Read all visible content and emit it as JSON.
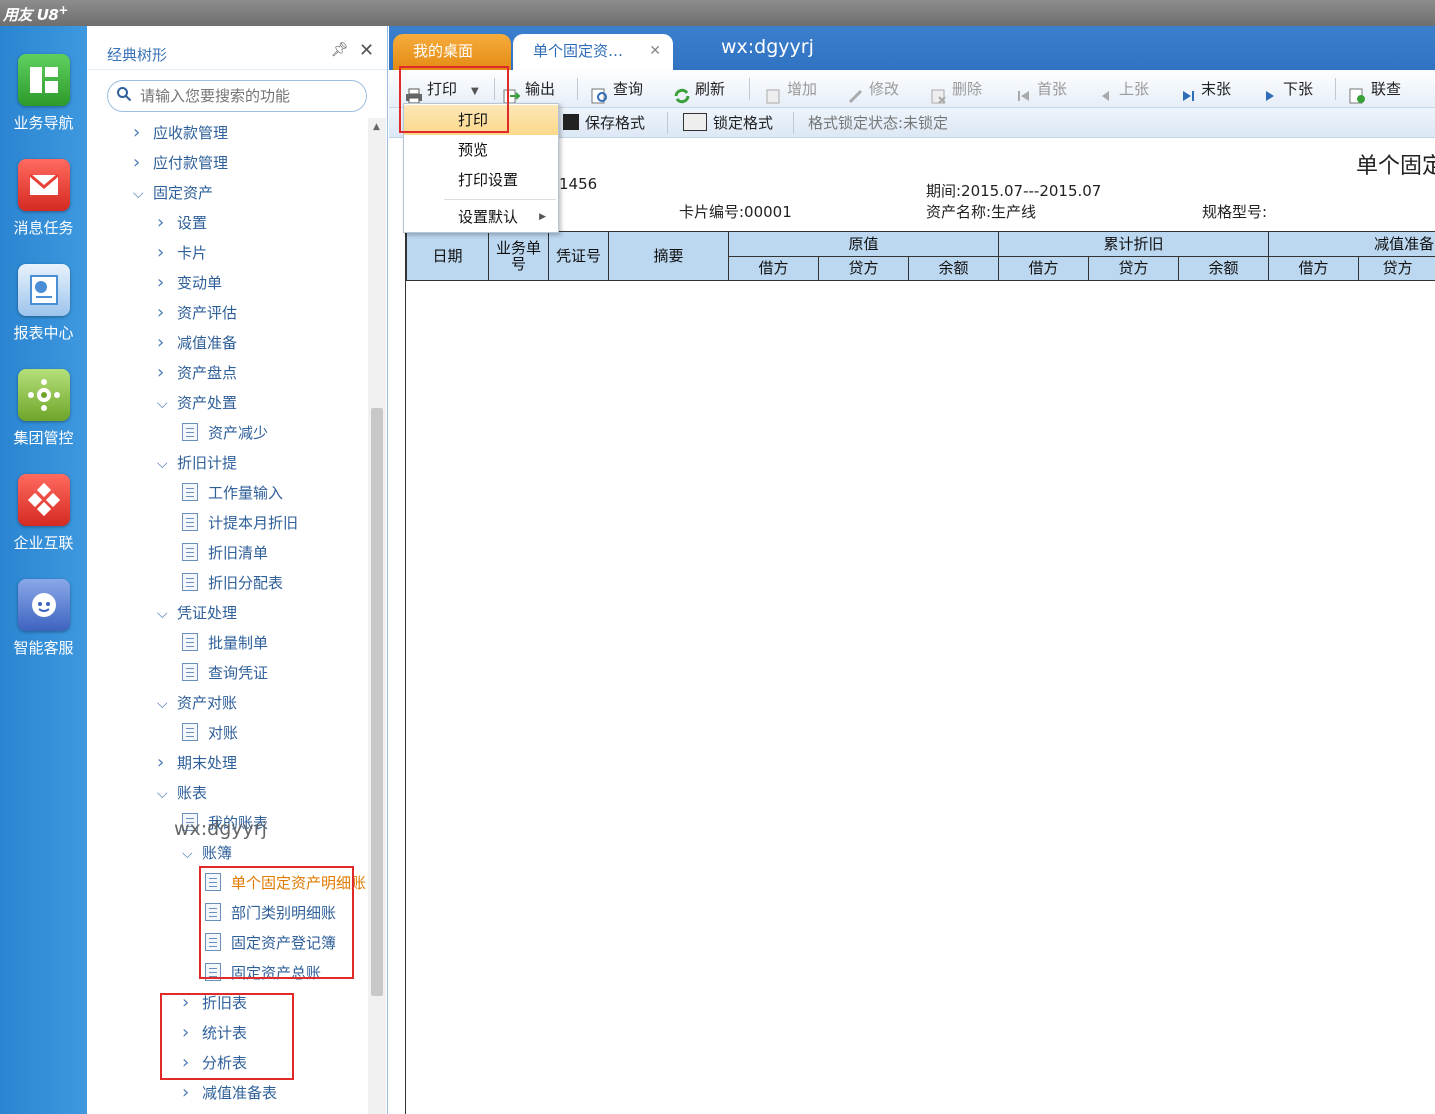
{
  "app": {
    "logo": "用友 U8",
    "logo_sup": "+",
    "watermark": "wx:dgyyrj"
  },
  "left_nav": [
    {
      "label": "业务导航",
      "icon": "business-nav-icon",
      "color": "#3db03d"
    },
    {
      "label": "消息任务",
      "icon": "message-task-icon",
      "color": "#e8423a"
    },
    {
      "label": "报表中心",
      "icon": "report-center-icon",
      "color": "#4a8fd6"
    },
    {
      "label": "集团管控",
      "icon": "group-control-icon",
      "color": "#8ec63f"
    },
    {
      "label": "企业互联",
      "icon": "enterprise-link-icon",
      "color": "#e8423a"
    },
    {
      "label": "智能客服",
      "icon": "smart-service-icon",
      "color": "#4a78c8"
    }
  ],
  "tree_panel": {
    "title": "经典树形",
    "search_placeholder": "请输入您要搜索的功能",
    "nodes": [
      {
        "label": "应收款管理",
        "type": "collapsed"
      },
      {
        "label": "应付款管理",
        "type": "collapsed"
      },
      {
        "label": "固定资产",
        "type": "expanded"
      },
      {
        "label": "设置",
        "type": "collapsed"
      },
      {
        "label": "卡片",
        "type": "collapsed"
      },
      {
        "label": "变动单",
        "type": "collapsed"
      },
      {
        "label": "资产评估",
        "type": "collapsed"
      },
      {
        "label": "减值准备",
        "type": "collapsed"
      },
      {
        "label": "资产盘点",
        "type": "collapsed"
      },
      {
        "label": "资产处置",
        "type": "expanded"
      },
      {
        "label": "资产减少",
        "type": "doc"
      },
      {
        "label": "折旧计提",
        "type": "expanded"
      },
      {
        "label": "工作量输入",
        "type": "doc"
      },
      {
        "label": "计提本月折旧",
        "type": "doc"
      },
      {
        "label": "折旧清单",
        "type": "doc"
      },
      {
        "label": "折旧分配表",
        "type": "doc"
      },
      {
        "label": "凭证处理",
        "type": "expanded"
      },
      {
        "label": "批量制单",
        "type": "doc"
      },
      {
        "label": "查询凭证",
        "type": "doc"
      },
      {
        "label": "资产对账",
        "type": "expanded"
      },
      {
        "label": "对账",
        "type": "doc"
      },
      {
        "label": "期末处理",
        "type": "collapsed"
      },
      {
        "label": "账表",
        "type": "expanded"
      },
      {
        "label": "我的账表",
        "type": "doc"
      },
      {
        "label": "账簿",
        "type": "expanded"
      },
      {
        "label": "单个固定资产明细账",
        "type": "doc",
        "active": true
      },
      {
        "label": "部门类别明细账",
        "type": "doc"
      },
      {
        "label": "固定资产登记簿",
        "type": "doc"
      },
      {
        "label": "固定资产总账",
        "type": "doc"
      },
      {
        "label": "折旧表",
        "type": "collapsed"
      },
      {
        "label": "统计表",
        "type": "collapsed"
      },
      {
        "label": "分析表",
        "type": "collapsed"
      },
      {
        "label": "减值准备表",
        "type": "collapsed"
      }
    ]
  },
  "tabs": {
    "desktop": "我的桌面",
    "current": "单个固定资…"
  },
  "toolbar": [
    {
      "label": "打印",
      "enabled": true
    },
    {
      "label": "输出",
      "enabled": true
    },
    {
      "label": "查询",
      "enabled": true
    },
    {
      "label": "刷新",
      "enabled": true
    },
    {
      "label": "增加",
      "enabled": false
    },
    {
      "label": "修改",
      "enabled": false
    },
    {
      "label": "删除",
      "enabled": false
    },
    {
      "label": "首张",
      "enabled": false
    },
    {
      "label": "上张",
      "enabled": false
    },
    {
      "label": "末张",
      "enabled": true
    },
    {
      "label": "下张",
      "enabled": true
    },
    {
      "label": "联查",
      "enabled": true
    }
  ],
  "toolbar2": {
    "save_format": "保存格式",
    "lock_format": "锁定格式",
    "lock_status": "格式锁定状态:未锁定"
  },
  "print_menu": {
    "items": [
      "打印",
      "预览",
      "打印设置",
      "设置默认"
    ],
    "highlighted": "打印"
  },
  "report": {
    "title": "单个固定",
    "partial_number": "1456",
    "card_no": "卡片编号:00001",
    "period": "期间:2015.07---2015.07",
    "asset_name": "资产名称:生产线",
    "model": "规格型号:",
    "columns": {
      "date": "日期",
      "biz_no": "业务单号",
      "voucher": "凭证号",
      "summary": "摘要",
      "groups": [
        "原值",
        "累计折旧",
        "减值准备"
      ],
      "sub": [
        "借方",
        "贷方",
        "余额"
      ]
    }
  }
}
